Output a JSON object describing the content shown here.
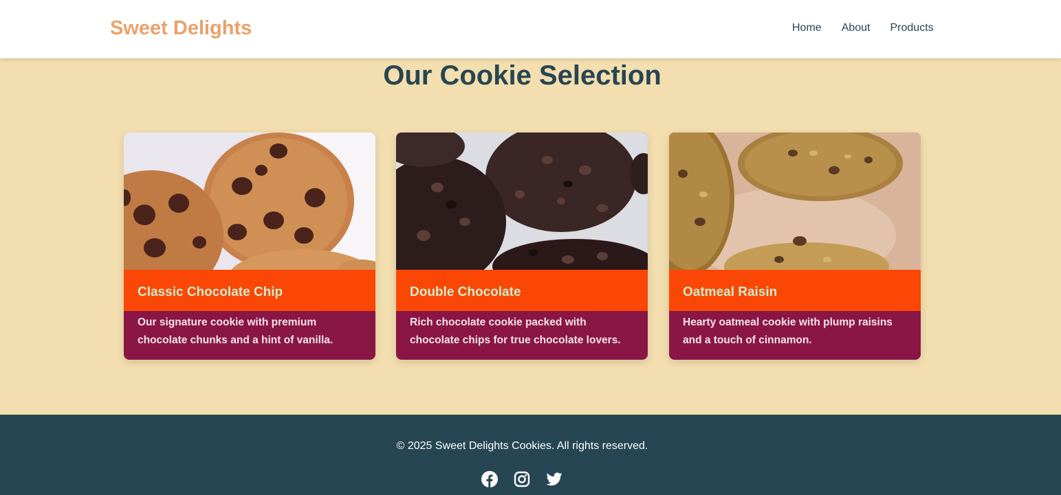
{
  "header": {
    "brand": "Sweet Delights",
    "nav": [
      "Home",
      "About",
      "Products"
    ]
  },
  "main": {
    "title": "Our Cookie Selection",
    "cards": [
      {
        "title": "Classic Chocolate Chip",
        "description": "Our signature cookie with premium chocolate chunks and a hint of vanilla."
      },
      {
        "title": "Double Chocolate",
        "description": "Rich chocolate cookie packed with chocolate chips for true chocolate lovers."
      },
      {
        "title": "Oatmeal Raisin",
        "description": "Hearty oatmeal cookie with plump raisins and a touch of cinnamon."
      }
    ]
  },
  "footer": {
    "copyright": "© 2025 Sweet Delights Cookies. All rights reserved.",
    "social": [
      "facebook-icon",
      "instagram-icon",
      "twitter-icon"
    ]
  },
  "colors": {
    "brand": "#eaa16a",
    "background": "#f2deae",
    "card_title_bg": "#fb4706",
    "card_title_text": "#c8eecb",
    "card_body_bg": "#8a1645",
    "footer_bg": "#264653"
  }
}
